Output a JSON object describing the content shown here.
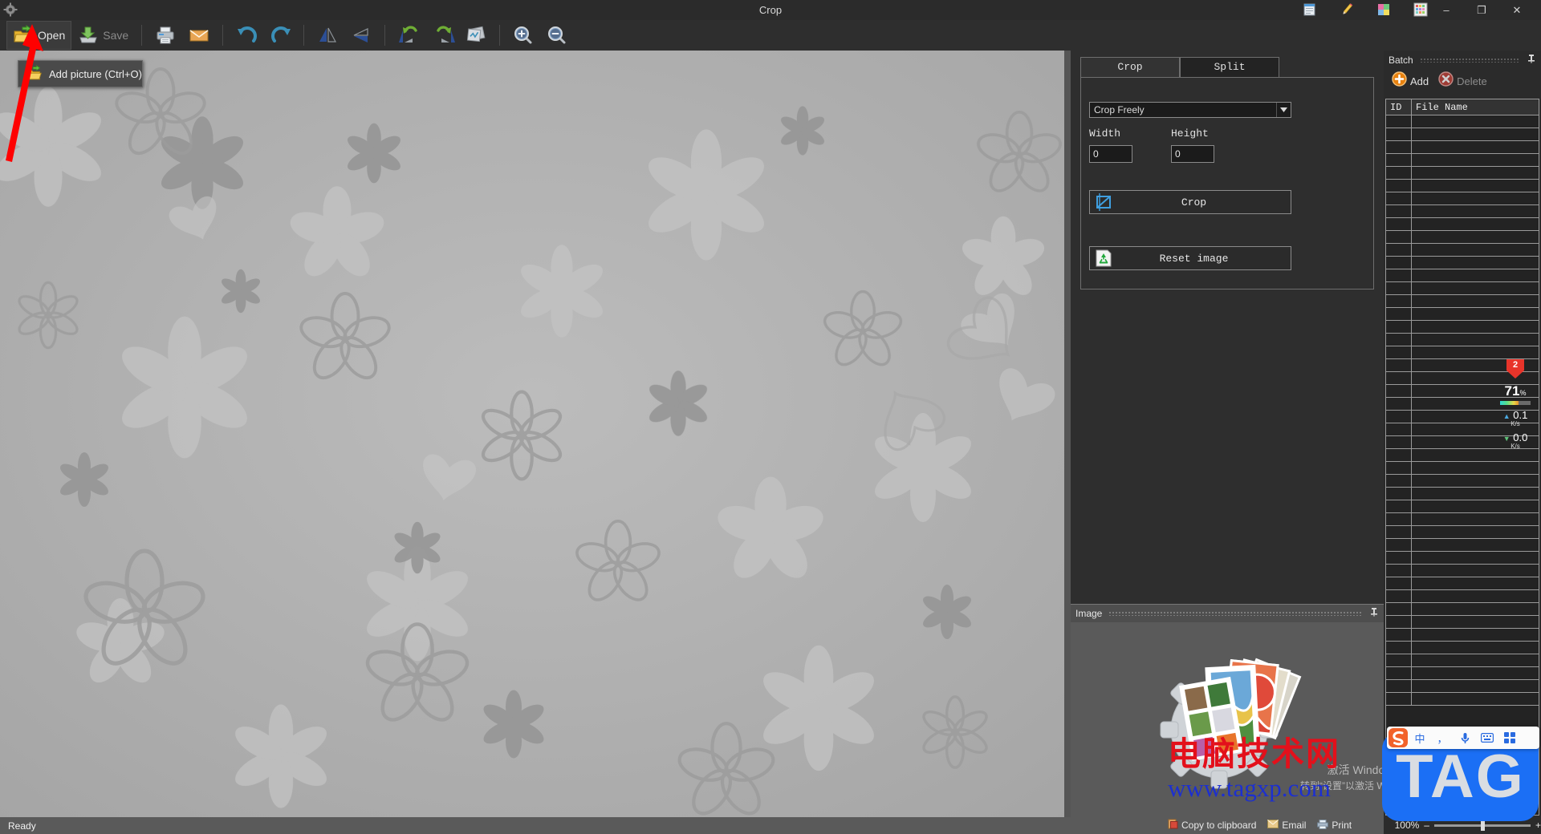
{
  "window": {
    "title": "Crop",
    "logo_icon": "app-gear-icon",
    "tray_icons": [
      "document-icon",
      "pencil-icon",
      "color-blocks-icon",
      "palette-grid-icon"
    ],
    "minimize_label": "–",
    "maximize_label": "❐",
    "close_label": "✕"
  },
  "toolbar": {
    "items": [
      {
        "name": "open-button",
        "label": "Open",
        "icon": "open-folder-icon",
        "active": true,
        "enabled": true
      },
      {
        "name": "save-button",
        "label": "Save",
        "icon": "save-disk-icon",
        "active": false,
        "enabled": false
      },
      {
        "name": "print-button",
        "label": "",
        "icon": "printer-icon",
        "active": false,
        "enabled": true
      },
      {
        "name": "email-button",
        "label": "",
        "icon": "envelope-icon",
        "active": false,
        "enabled": true
      },
      {
        "name": "undo-button",
        "label": "",
        "icon": "undo-arrow-icon",
        "active": false,
        "enabled": true
      },
      {
        "name": "redo-button",
        "label": "",
        "icon": "redo-arrow-icon",
        "active": false,
        "enabled": true
      },
      {
        "name": "flip-horizontal-button",
        "label": "",
        "icon": "flip-horizontal-icon",
        "active": false,
        "enabled": true
      },
      {
        "name": "flip-vertical-button",
        "label": "",
        "icon": "flip-vertical-icon",
        "active": false,
        "enabled": true
      },
      {
        "name": "rotate-left-button",
        "label": "",
        "icon": "rotate-left-icon",
        "active": false,
        "enabled": true
      },
      {
        "name": "rotate-right-button",
        "label": "",
        "icon": "rotate-right-icon",
        "active": false,
        "enabled": true
      },
      {
        "name": "effects-button",
        "label": "",
        "icon": "image-effects-icon",
        "active": false,
        "enabled": true
      },
      {
        "name": "zoom-in-button",
        "label": "",
        "icon": "zoom-in-icon",
        "active": false,
        "enabled": true
      },
      {
        "name": "zoom-out-button",
        "label": "",
        "icon": "zoom-out-icon",
        "active": false,
        "enabled": true
      }
    ]
  },
  "tooltip": {
    "text": "Add picture (Ctrl+O)",
    "icon": "open-folder-icon"
  },
  "annotation": {
    "arrow_color": "#ff0000",
    "arrow_name": "red-pointer-arrow"
  },
  "crop_panel": {
    "tabs": [
      {
        "label": "Crop",
        "selected": false
      },
      {
        "label": "Split",
        "selected": true
      }
    ],
    "mode_select": {
      "value": "Crop Freely",
      "options": [
        "Crop Freely"
      ]
    },
    "width": {
      "label": "Width",
      "value": "0"
    },
    "height": {
      "label": "Height",
      "value": "0"
    },
    "crop_button": {
      "label": "Crop",
      "icon": "crop-frame-icon"
    },
    "reset_button": {
      "label": "Reset image",
      "icon": "recycle-icon"
    }
  },
  "image_panel": {
    "title": "Image",
    "pin_icon": "pin-icon",
    "preview_icon": "photos-gear-icon"
  },
  "batch_panel": {
    "title": "Batch",
    "pin_icon": "pin-icon",
    "add_button": {
      "label": "Add",
      "icon": "plus-circle-icon"
    },
    "delete_button": {
      "label": "Delete",
      "icon": "x-circle-icon",
      "enabled": false
    },
    "columns": [
      "ID",
      "File Name"
    ],
    "rows": [],
    "empty_row_count": 46
  },
  "statusbar": {
    "text": "Ready"
  },
  "monitor_widget": {
    "badge_count": "2",
    "cpu_percent": "71",
    "percent_symbol": "%",
    "upload": {
      "value": "0.1",
      "unit": "K/s",
      "icon": "arrow-up-icon"
    },
    "download": {
      "value": "0.0",
      "unit": "K/s",
      "icon": "arrow-down-icon"
    }
  },
  "watermark": {
    "chinese": "电脑技术网",
    "url": "www.tagxp.com",
    "tag_logo": "TAG"
  },
  "windows_activation": {
    "line1": "激活 Windows",
    "line2": "转到“设置”以激活 Windows。"
  },
  "sogou_ime": {
    "logo_icon": "sogou-s-icon",
    "items": [
      {
        "name": "chinese-mode-icon",
        "glyph": "中"
      },
      {
        "name": "punctuation-icon",
        "glyph": "，"
      },
      {
        "name": "microphone-icon",
        "glyph": "🎤"
      },
      {
        "name": "keyboard-icon",
        "glyph": "⌨"
      },
      {
        "name": "toolbox-icon",
        "glyph": "░"
      }
    ]
  },
  "bottom_bar": {
    "items": [
      {
        "name": "copy-to-clipboard-button",
        "label": "Copy to clipboard",
        "icon": "clipboard-icon"
      },
      {
        "name": "email-button",
        "label": "Email",
        "icon": "mail-icon"
      },
      {
        "name": "print-button",
        "label": "Print",
        "icon": "printer-icon"
      }
    ],
    "zoom": {
      "level": "100%",
      "minus": "–",
      "plus": "+"
    }
  },
  "colors": {
    "titlebar_bg": "#2b2b2b",
    "toolbar_bg": "#2e2e2e",
    "canvas_bg": "#b3b3b3",
    "panel_bg": "#2e2e2e",
    "statusbar_bg": "#5a5a5a",
    "accent_blue": "#1b6ff5",
    "watermark_red": "#e3101b",
    "watermark_blue": "#1c2fd0"
  }
}
